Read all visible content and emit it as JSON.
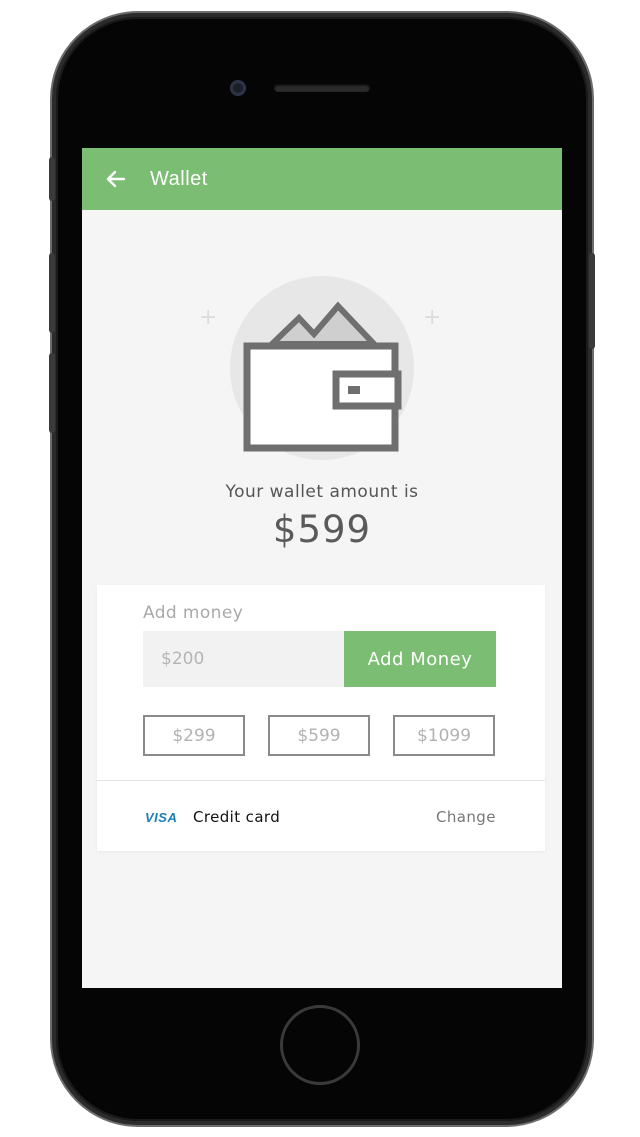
{
  "header": {
    "title": "Wallet",
    "back_icon": "arrow-left-icon"
  },
  "hero": {
    "icon": "wallet-icon",
    "label": "Your wallet amount is",
    "amount": "$599"
  },
  "add_money": {
    "label": "Add money",
    "input_placeholder": "$200",
    "button_label": "Add Money",
    "presets": [
      "$299",
      "$599",
      "$1099"
    ]
  },
  "payment": {
    "card_brand": "VISA",
    "method_label": "Credit card",
    "change_label": "Change"
  },
  "colors": {
    "accent": "#7bbd72",
    "screen_background": "#f5f5f5",
    "visa_blue": "#1a7fb6"
  }
}
